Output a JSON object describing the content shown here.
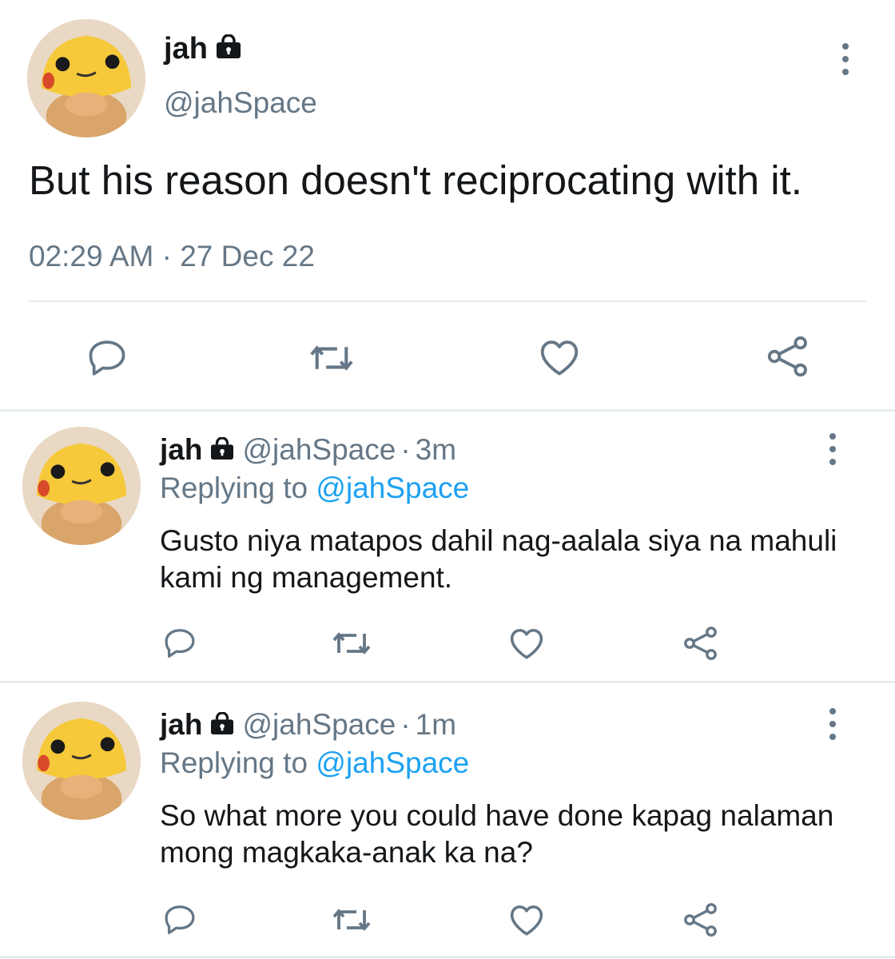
{
  "main_tweet": {
    "name": "jah",
    "handle": "@jahSpace",
    "text": "But his reason doesn't reciprocating with it.",
    "time": "02:29 AM",
    "date": "27 Dec 22",
    "separator": "·"
  },
  "replies": [
    {
      "name": "jah",
      "handle": "@jahSpace",
      "separator": "·",
      "time": "3m",
      "replying_label": "Replying to",
      "replying_to": "@jahSpace",
      "text": "Gusto niya matapos dahil nag-aalala siya na mahuli kami ng management."
    },
    {
      "name": "jah",
      "handle": "@jahSpace",
      "separator": "·",
      "time": "1m",
      "replying_label": "Replying to",
      "replying_to": "@jahSpace",
      "text": "So what more you could have done kapag nalaman mong magkaka-anak ka na?"
    }
  ],
  "icons": [
    "lock-icon",
    "more-icon",
    "reply-icon",
    "retweet-icon",
    "like-icon",
    "share-icon"
  ],
  "colors": {
    "text": "#14171a",
    "secondary": "#657786",
    "link": "#1da1f2",
    "divider": "#e6ecf0"
  }
}
